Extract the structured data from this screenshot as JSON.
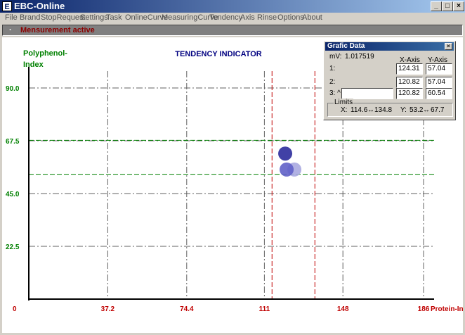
{
  "window": {
    "title": "EBC-Online",
    "icon": "ebc-app-icon",
    "icon_text": "E"
  },
  "window_buttons": {
    "minimize": "_",
    "maximize": "□",
    "close": "×"
  },
  "menu": [
    "File",
    "Brand",
    "StopRequest",
    "Settings",
    "Task",
    "OnlineCurve",
    "MeasuringCurve",
    "Tendency",
    "Axis",
    "Rinse",
    "Options",
    "About"
  ],
  "status": {
    "bullet": "·",
    "text": "Mensurement active"
  },
  "chart_data": {
    "type": "scatter",
    "title": "TENDENCY INDICATOR",
    "ylabel": [
      "Polyphenol-",
      "Index"
    ],
    "xlabel": "Protein-Index",
    "xlim": [
      0,
      186
    ],
    "ylim": [
      0,
      90
    ],
    "origin_label": "0",
    "x_ticks": [
      37.2,
      74.4,
      111,
      148,
      186
    ],
    "x_tick_labels": [
      "37.2",
      "74.4",
      "111",
      "148",
      "186"
    ],
    "y_ticks": [
      22.5,
      45.0,
      67.5,
      90.0
    ],
    "y_tick_labels": [
      "22.5",
      "45.0",
      "67.5",
      "90.0"
    ],
    "grid": true,
    "limits": {
      "x": [
        114.6,
        134.8
      ],
      "y": [
        53.2,
        67.7
      ]
    },
    "points": [
      {
        "x": 120.82,
        "y": 57.04,
        "color": "#a8a8e0"
      },
      {
        "x": 120.82,
        "y": 57.04,
        "color": "#6060c8"
      },
      {
        "x": 120.82,
        "y": 60.54,
        "color": "#2c2c9c"
      }
    ],
    "colors": {
      "axis_labels": "#008000",
      "x_ticks": "#c00000",
      "title": "#000080",
      "y_limits": "#008000",
      "x_limits": "#c00000",
      "grid": "#606060"
    }
  },
  "grafic_panel": {
    "title": "Grafic Data",
    "close": "×",
    "mv_label": "mV:",
    "mv_value": "1.017519",
    "x_axis_label": "X-Axis",
    "y_axis_label": "Y-Axis",
    "rows": [
      {
        "label": "1:",
        "x": "124.31",
        "y": "57.04"
      },
      {
        "label": "2:",
        "x": "120.82",
        "y": "57.04"
      },
      {
        "label": "3: ^",
        "x": "120.82",
        "y": "60.54"
      }
    ],
    "limits_label": "Limits",
    "limits_x_label": "X:",
    "limits_x_min": "114.6",
    "limits_x_max": "134.8",
    "limits_y_label": "Y:",
    "limits_y_min": "53.2",
    "limits_y_max": "67.7",
    "arrow": "↔"
  }
}
